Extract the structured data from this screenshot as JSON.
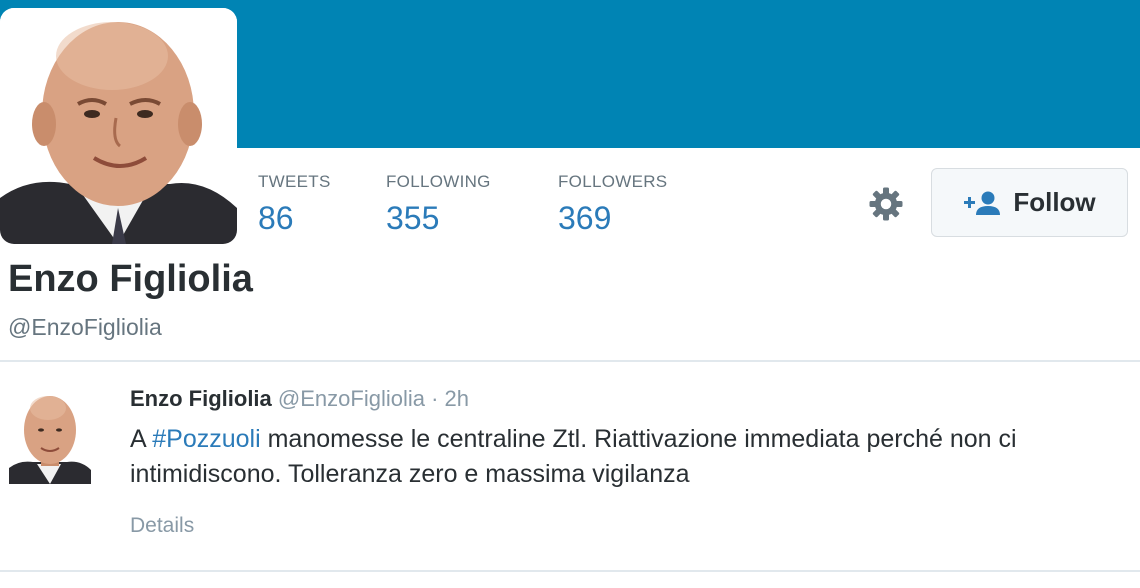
{
  "profile": {
    "name": "Enzo Figliolia",
    "handle": "@EnzoFigliolia",
    "banner_color": "#0084b4"
  },
  "stats": [
    {
      "label": "TWEETS",
      "value": "86"
    },
    {
      "label": "FOLLOWING",
      "value": "355"
    },
    {
      "label": "FOLLOWERS",
      "value": "369"
    }
  ],
  "actions": {
    "settings_icon": "gear-icon",
    "follow_icon": "add-person-icon",
    "follow_label": "Follow"
  },
  "tweet": {
    "author": "Enzo Figliolia",
    "handle": "@EnzoFigliolia",
    "separator": "·",
    "time": "2h",
    "text_before": "A ",
    "hashtag": "#Pozzuoli",
    "text_after": " manomesse le centraline Ztl. Riattivazione immediata perché non ci intimidiscono. Tolleranza zero e massima vigilanza",
    "details_label": "Details"
  },
  "colors": {
    "link": "#2b7bb9",
    "muted": "#8899a6",
    "text": "#292f33"
  }
}
